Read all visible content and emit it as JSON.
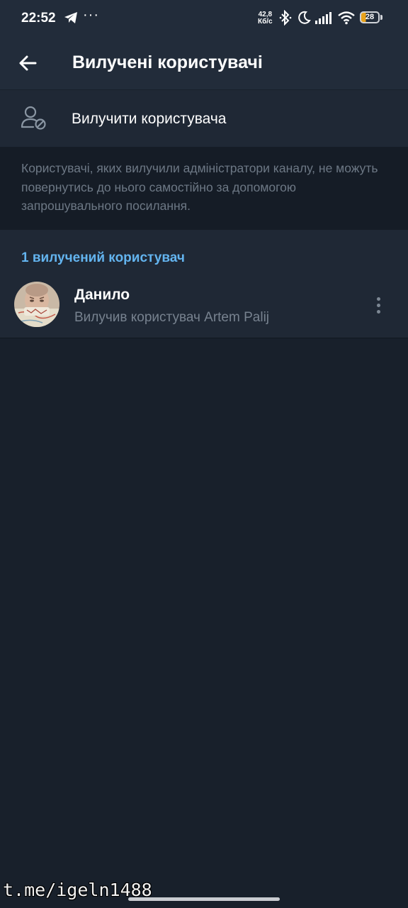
{
  "status_bar": {
    "time": "22:52",
    "more": "···",
    "net_speed_value": "42,8",
    "net_speed_unit": "Кб/с",
    "battery_level": "28",
    "icons": [
      "telegram-icon",
      "more-icon",
      "bluetooth-icon",
      "moon-icon",
      "signal-icon",
      "wifi-icon",
      "battery-icon"
    ]
  },
  "header": {
    "title": "Вилучені користувачі",
    "back_icon": "arrow-left-icon"
  },
  "action": {
    "label": "Вилучити користувача",
    "icon": "user-remove-icon"
  },
  "info": {
    "text": "Користувачі, яких вилучили адміністратори каналу, не можуть повернутись до нього самостійно за допомогою запрошувального посилання."
  },
  "section": {
    "header": "1 вилучений користувач"
  },
  "users": [
    {
      "name": "Данило",
      "subtitle": "Вилучив користувач Artem Palij",
      "avatar_icon": "avatar-photo",
      "menu_icon": "more-vertical-icon"
    }
  ],
  "watermark": "t.me/igeln1488",
  "colors": {
    "background": "#18202b",
    "bar": "#222c3a",
    "row": "#1f2835",
    "info_background": "#151c26",
    "accent": "#63b4ef",
    "secondary_text": "#77828f"
  }
}
